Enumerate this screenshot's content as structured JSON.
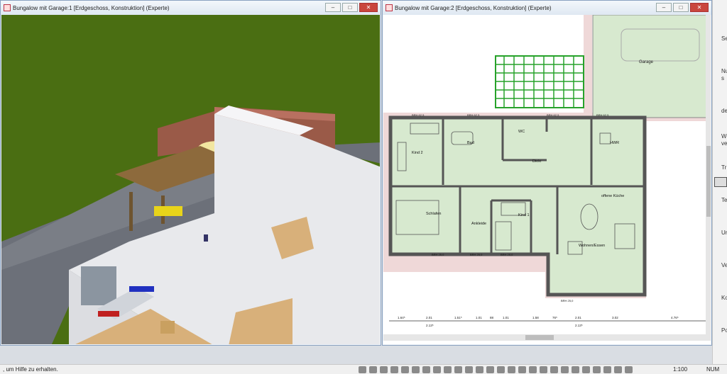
{
  "window_left": {
    "title": "Bungalow mit Garage:1 [Erdgeschoss, Konstruktion] (Experte)",
    "controls": {
      "minimize": "–",
      "maximize": "□",
      "close": "✕"
    }
  },
  "window_right": {
    "title": "Bungalow mit Garage:2 [Erdgeschoss, Konstruktion] (Experte)",
    "controls": {
      "minimize": "–",
      "maximize": "□",
      "close": "✕"
    },
    "rooms": {
      "garage": "Garage",
      "kind2": "Kind 2",
      "bad": "Bad",
      "wc": "WC",
      "diele": "Diele",
      "hwr": "HWR",
      "schlafen": "Schlafen",
      "ankleide": "Ankleide",
      "kind1": "Kind 1",
      "kueche": "offene Küche",
      "wohnen": "Wohnen/Essen"
    },
    "brh_labels": [
      "BRH 62,5",
      "BRH 62,5",
      "BRH 62,5",
      "BRH 62,5",
      "BRH 25,0",
      "BRH 25,0",
      "BRH 25,0",
      "BRH 25,0"
    ],
    "dimensions": [
      "1.64⁵",
      "2.01",
      "1.51⁵",
      "1.01",
      "88",
      "1.01",
      "1.58",
      "76⁵",
      "2.01",
      "3.02",
      "4.76⁵"
    ],
    "dimensions_sub": [
      "2.13⁵",
      "2.13⁵"
    ]
  },
  "side_panel": {
    "labels": [
      "Se",
      "Nu",
      "s",
      "de",
      "W",
      "ve",
      "Tr",
      "Te",
      "Ur",
      "Ve",
      "Ko",
      "Po"
    ]
  },
  "status_bar": {
    "hint": ", um Hilfe zu erhalten.",
    "scale": "1:100",
    "num": "NUM"
  },
  "colors": {
    "lawn": "#4a6e12",
    "paving": "#6c7079",
    "wall_3d": "#e8e9ec",
    "floor_wood": "#d8b07a",
    "plan_room": "#d7e9cf",
    "plan_outside": "#efd8d8",
    "carport_wood": "#8d6a3c",
    "title_bar": "#e4ecf4",
    "close_button": "#c9463d"
  }
}
